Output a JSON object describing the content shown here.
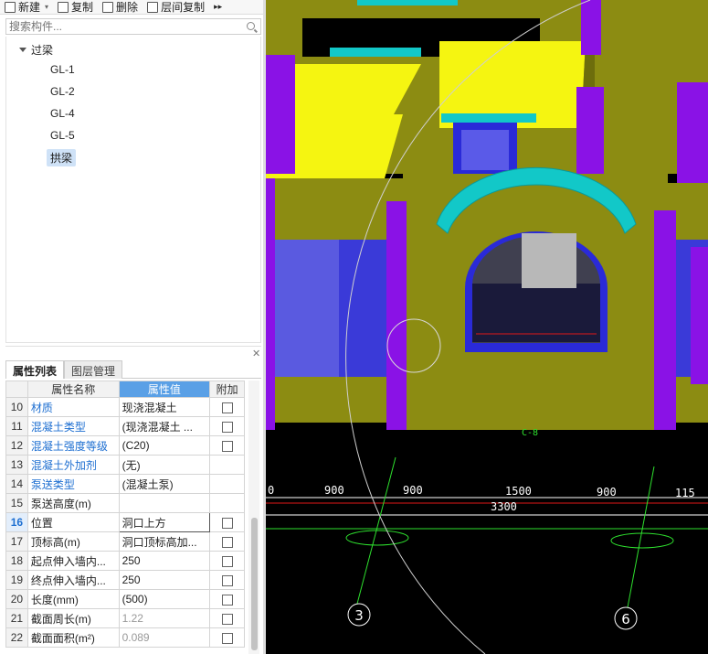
{
  "toolbar": {
    "new_label": "新建",
    "copy_label": "复制",
    "delete_label": "删除",
    "floor_copy_label": "层间复制",
    "more": "▸▸"
  },
  "search": {
    "placeholder": "搜索构件..."
  },
  "tree": {
    "root_label": "过梁",
    "items": [
      "GL-1",
      "GL-2",
      "GL-4",
      "GL-5",
      "拱梁"
    ],
    "selected_index": 4
  },
  "panel": {
    "close": "✕",
    "tabs": [
      "属性列表",
      "图层管理"
    ],
    "active_tab": 0,
    "headers": {
      "name": "属性名称",
      "value": "属性值",
      "extra": "附加"
    },
    "rows": [
      {
        "num": "10",
        "name": "材质",
        "value": "现浇混凝土",
        "checkbox": true
      },
      {
        "num": "11",
        "name": "混凝土类型",
        "value": "(现浇混凝土   ...",
        "checkbox": true
      },
      {
        "num": "12",
        "name": "混凝土强度等级",
        "value": "(C20)",
        "checkbox": true
      },
      {
        "num": "13",
        "name": "混凝土外加剂",
        "value": "(无)",
        "checkbox": false
      },
      {
        "num": "14",
        "name": "泵送类型",
        "value": "(混凝土泵)",
        "checkbox": false
      },
      {
        "num": "15",
        "name": "泵送高度(m)",
        "value": "",
        "checkbox": false
      },
      {
        "num": "16",
        "name": "位置",
        "value": "洞口上方",
        "checkbox": true
      },
      {
        "num": "17",
        "name": "顶标高(m)",
        "value": "洞口顶标高加...",
        "checkbox": true
      },
      {
        "num": "18",
        "name": "起点伸入墙内...",
        "value": "250",
        "checkbox": true
      },
      {
        "num": "19",
        "name": "终点伸入墙内...",
        "value": "250",
        "checkbox": true
      },
      {
        "num": "20",
        "name": "长度(mm)",
        "value": "(500)",
        "checkbox": true
      },
      {
        "num": "21",
        "name": "截面周长(m)",
        "value": "1.22",
        "checkbox": true
      },
      {
        "num": "22",
        "name": "截面面积(m²)",
        "value": "0.089",
        "checkbox": true
      }
    ]
  },
  "viewport": {
    "dims_top": [
      "0",
      "900",
      "900",
      "1500",
      "900",
      "115"
    ],
    "dim_total": "3300",
    "wall_label": "C-8",
    "axis_labels": [
      "3",
      "6"
    ],
    "colors": {
      "wall_olive": "#8c8c12",
      "wall_olive_dark": "#6d6d0c",
      "beam_yellow": "#f5f511",
      "column_purple": "#8a12e6",
      "blue": "#2a2ad8",
      "cyan": "#12c8c8",
      "dim_white": "#ffffff",
      "axis_green": "#2ee02e",
      "red": "#e01818"
    }
  }
}
